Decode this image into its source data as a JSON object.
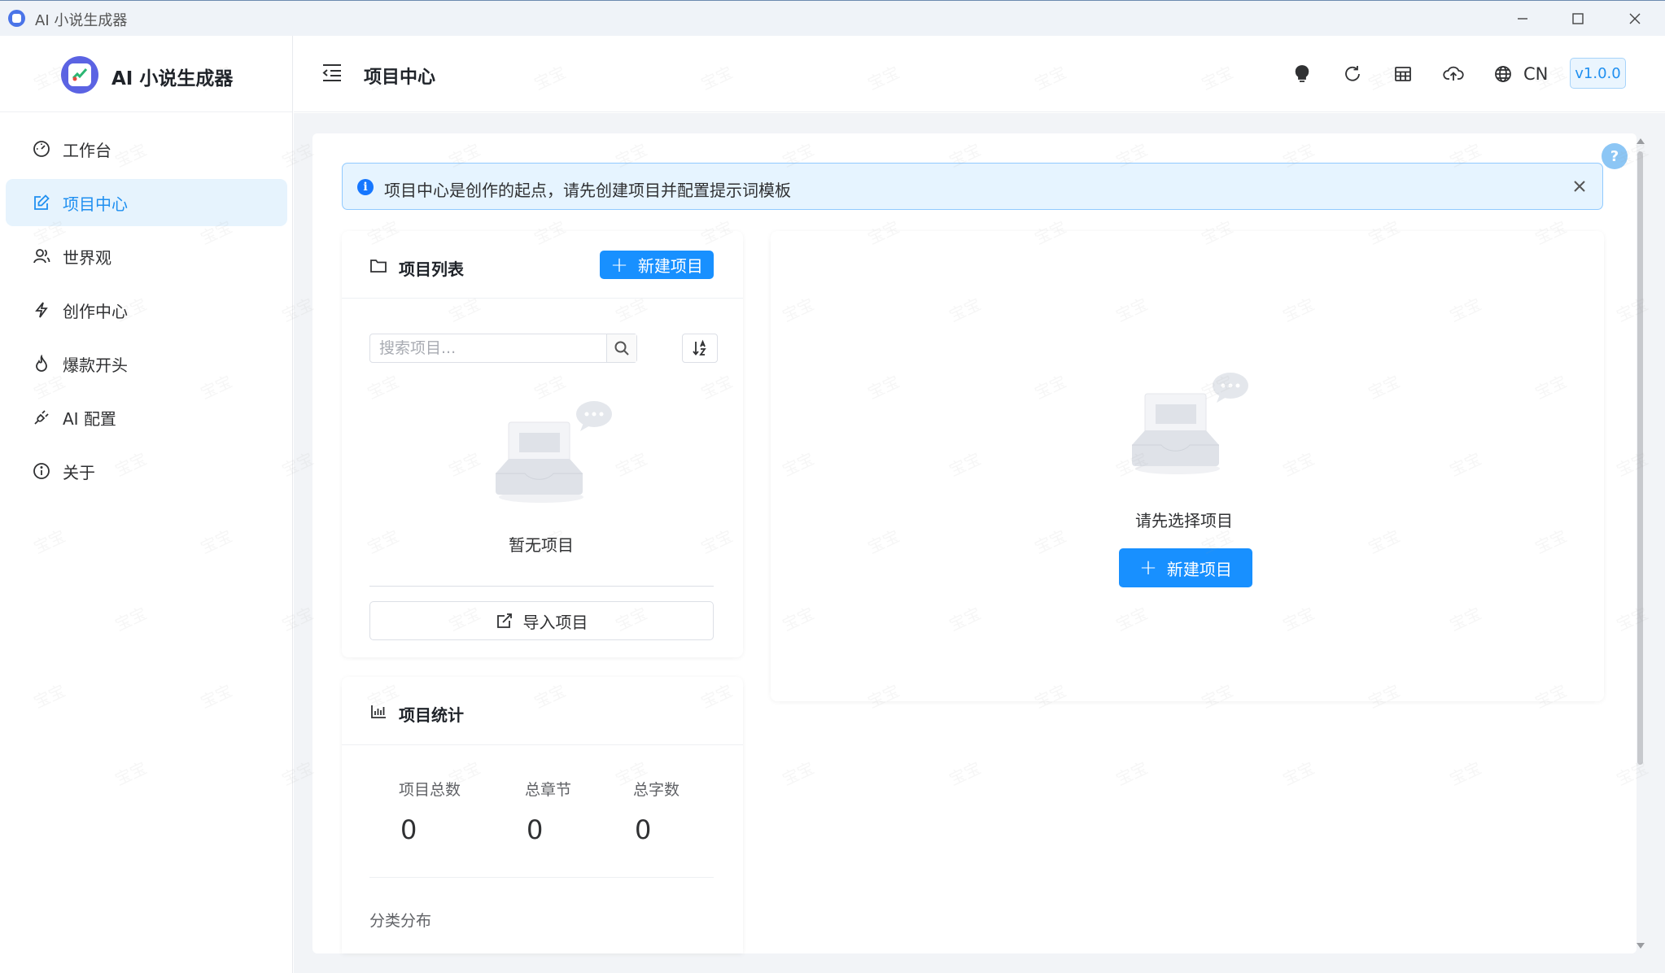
{
  "window": {
    "title": "AI 小说生成器"
  },
  "sidebar": {
    "logo_text": "AI 小说生成器",
    "items": [
      {
        "label": "工作台",
        "icon": "dashboard-icon",
        "active": false
      },
      {
        "label": "项目中心",
        "icon": "edit-icon",
        "active": true
      },
      {
        "label": "世界观",
        "icon": "people-icon",
        "active": false
      },
      {
        "label": "创作中心",
        "icon": "lightning-icon",
        "active": false
      },
      {
        "label": "爆款开头",
        "icon": "fire-icon",
        "active": false
      },
      {
        "label": "AI 配置",
        "icon": "plug-icon",
        "active": false
      },
      {
        "label": "关于",
        "icon": "info-icon",
        "active": false
      }
    ]
  },
  "header": {
    "title": "项目中心",
    "language": "CN",
    "version": "v1.0.0"
  },
  "alert": {
    "text": "项目中心是创作的起点，请先创建项目并配置提示词模板"
  },
  "project_list": {
    "title": "项目列表",
    "new_button": "新建项目",
    "search_placeholder": "搜索项目...",
    "empty_text": "暂无项目",
    "import_button": "导入项目"
  },
  "stats": {
    "title": "项目统计",
    "items": [
      {
        "label": "项目总数",
        "value": "0"
      },
      {
        "label": "总章节",
        "value": "0"
      },
      {
        "label": "总字数",
        "value": "0"
      }
    ],
    "category_title": "分类分布"
  },
  "detail": {
    "empty_text": "请先选择项目",
    "new_button": "新建项目"
  },
  "watermark": "宝宝",
  "colors": {
    "accent": "#1890ff",
    "active_bg": "#e6f3fd",
    "alert_bg": "#e6f4ff"
  }
}
